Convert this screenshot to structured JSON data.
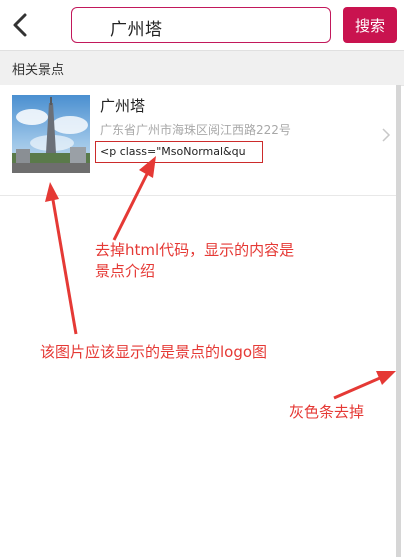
{
  "header": {
    "search_value": "广州塔",
    "search_button": "搜索"
  },
  "section": {
    "title": "相关景点"
  },
  "result": {
    "title": "广州塔",
    "address": "广东省广州市海珠区阅江西路222号",
    "description": "<p class=\"MsoNormal&qu"
  },
  "annotations": {
    "html_note_line1": "去掉html代码，显示的内容是",
    "html_note_line2": "景点介绍",
    "logo_note": "该图片应该显示的是景点的logo图",
    "scrollbar_note": "灰色条去掉"
  },
  "colors": {
    "accent": "#c9134f",
    "annotation": "#e53935",
    "scrollbar": "#d6d6d6"
  },
  "icons": {
    "back": "chevron-left-icon",
    "item_arrow": "chevron-right-icon"
  }
}
